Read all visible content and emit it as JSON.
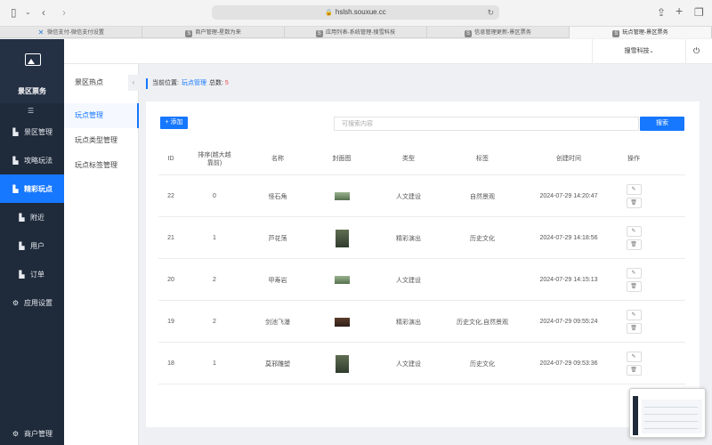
{
  "browser": {
    "url": "hslsh.souxue.cc",
    "tabs": [
      {
        "label": "微信支付-微信支付设置",
        "icon": "wechat-pay-icon",
        "active": false
      },
      {
        "label": "商户管理-星数为来",
        "icon": "s-site-icon",
        "active": false
      },
      {
        "label": "应用列表-系统管理-搜雪科技",
        "icon": "s-site-icon",
        "active": false
      },
      {
        "label": "信息管理更新-景区票务",
        "icon": "s-site-icon",
        "active": false
      },
      {
        "label": "玩点管理-景区票务",
        "icon": "s-site-icon",
        "active": true
      }
    ]
  },
  "sidebar": {
    "title": "景区票务",
    "items": [
      {
        "label": "景区管理",
        "icon": "file-icon",
        "active": false,
        "sub": false
      },
      {
        "label": "攻略玩法",
        "icon": "file-icon",
        "active": false,
        "sub": false
      },
      {
        "label": "精彩玩点",
        "icon": "file-icon",
        "active": true,
        "sub": false
      },
      {
        "label": "附近",
        "icon": "file-icon",
        "active": false,
        "sub": true
      },
      {
        "label": "用户",
        "icon": "file-icon",
        "active": false,
        "sub": true
      },
      {
        "label": "订单",
        "icon": "file-icon",
        "active": false,
        "sub": true
      },
      {
        "label": "应用设置",
        "icon": "gear-icon",
        "active": false,
        "sub": false
      }
    ],
    "bottom_item": {
      "label": "商户管理",
      "icon": "gear-icon"
    }
  },
  "topbar": {
    "company": "搜雪科技",
    "company_caret": "⌄"
  },
  "subnav": {
    "title": "景区热点",
    "toggle": "‹",
    "items": [
      {
        "label": "玩点管理",
        "active": true
      },
      {
        "label": "玩点类型管理",
        "active": false
      },
      {
        "label": "玩点标签管理",
        "active": false
      }
    ]
  },
  "breadcrumb": {
    "prefix": "当前位置:",
    "current": "玩点管理",
    "total_label": "总数:",
    "total": "5"
  },
  "toolbar": {
    "add_label": "+ 添加",
    "search_placeholder": "可搜索内容",
    "search_button": "搜索"
  },
  "table": {
    "headers": [
      "ID",
      "排序(越大越靠前)",
      "名称",
      "封面图",
      "类型",
      "标签",
      "创建时间",
      "操作"
    ],
    "rows": [
      {
        "id": "22",
        "sort": "0",
        "name": "怪石角",
        "thumb": "wide",
        "type": "人文建设",
        "tags": "自然景观",
        "created": "2024-07-29 14:20:47"
      },
      {
        "id": "21",
        "sort": "1",
        "name": "芦花荡",
        "thumb": "tall",
        "type": "精彩演出",
        "tags": "历史文化",
        "created": "2024-07-29 14:18:56"
      },
      {
        "id": "20",
        "sort": "2",
        "name": "甲寿岩",
        "thumb": "wide",
        "type": "人文建设",
        "tags": "",
        "created": "2024-07-29 14:15:13"
      },
      {
        "id": "19",
        "sort": "2",
        "name": "剑池飞瀑",
        "thumb": "small",
        "type": "精彩演出",
        "tags": "历史文化,自然景观",
        "created": "2024-07-29 09:55:24"
      },
      {
        "id": "18",
        "sort": "1",
        "name": "莫邪雕塑",
        "thumb": "tall",
        "type": "人文建设",
        "tags": "历史文化",
        "created": "2024-07-29 09:53:36"
      }
    ],
    "edit_icon": "✎",
    "delete_icon": "🗑"
  }
}
